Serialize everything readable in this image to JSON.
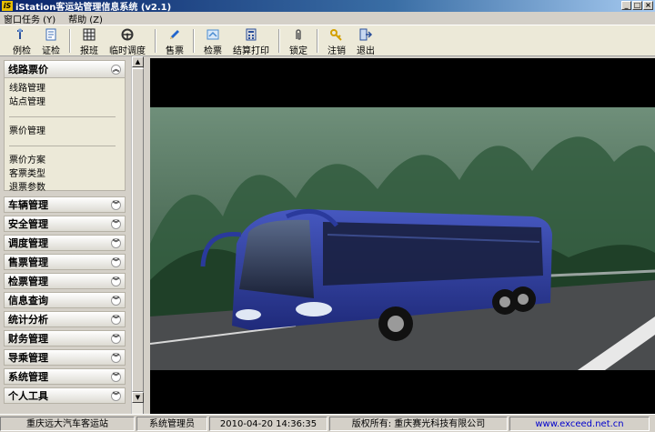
{
  "window": {
    "title": "iStation客运站管理信息系统 (v2.1)",
    "icon_text": "iS",
    "controls": {
      "minimize": "_",
      "maximize": "□",
      "close": "×"
    }
  },
  "menu": [
    {
      "label": "窗口任务 (Y)"
    },
    {
      "label": "帮助 (Z)"
    }
  ],
  "toolbar": {
    "items": [
      {
        "label": "例检",
        "icon": "wrench-icon",
        "color": "#2a4f9a"
      },
      {
        "label": "证检",
        "icon": "document-icon",
        "color": "#3b6cb5"
      },
      {
        "label": "报班",
        "icon": "grid-icon",
        "color": "#222222"
      },
      {
        "label": "临时调度",
        "icon": "steering-wheel-icon",
        "color": "#333333"
      },
      {
        "label": "售票",
        "icon": "pen-icon",
        "color": "#2266cc"
      },
      {
        "label": "检票",
        "icon": "ticket-icon",
        "color": "#4a8cd0"
      },
      {
        "label": "结算打印",
        "icon": "calculator-icon",
        "color": "#2a4f9a"
      },
      {
        "label": "锁定",
        "icon": "clip-icon",
        "color": "#5a5a5a"
      },
      {
        "label": "注销",
        "icon": "key-icon",
        "color": "#d4a000"
      },
      {
        "label": "退出",
        "icon": "exit-icon",
        "color": "#2a4f9a"
      }
    ]
  },
  "sidebar": {
    "expanded": {
      "title": "线路票价",
      "chevron": "up",
      "groups": [
        [
          "线路管理",
          "站点管理"
        ],
        [
          "票价管理"
        ],
        [
          "票价方案",
          "客票类型",
          "退票参数"
        ]
      ]
    },
    "collapsed": [
      "车辆管理",
      "安全管理",
      "调度管理",
      "售票管理",
      "检票管理",
      "信息查询",
      "统计分析",
      "财务管理",
      "导乘管理",
      "系统管理",
      "个人工具"
    ]
  },
  "statusbar": {
    "station": "重庆远大汽车客运站",
    "user": "系统管理员",
    "datetime": "2010-04-20  14:36:35",
    "copyright": "版权所有: 重庆赛光科技有限公司",
    "website": "www.exceed.net.cn"
  },
  "colors": {
    "bus_body": "#2a3a9c",
    "forest": "#2f5a3c",
    "road": "#4a4c4e"
  }
}
